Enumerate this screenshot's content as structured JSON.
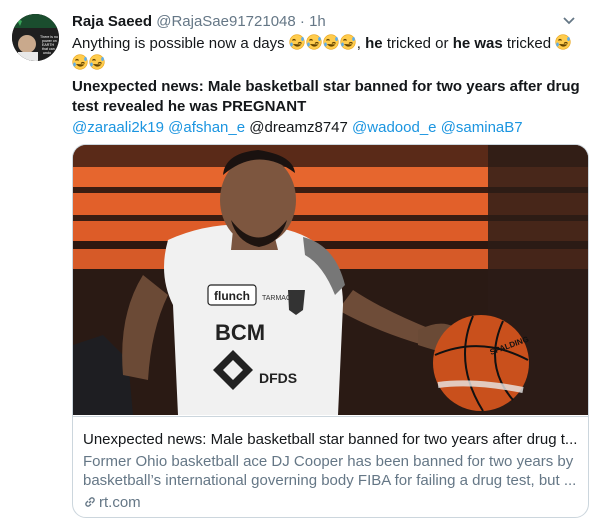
{
  "tweet": {
    "author_name": "Raja Saeed",
    "author_handle": "@RajaSae91721048",
    "separator": "·",
    "timestamp": "1h",
    "line1_text": "Anything is possible now a days ",
    "line1_he_1": "he",
    "line1_tricked_or": " tricked or ",
    "line1_he_was": "he was",
    "line1_tricked": " tricked ",
    "headline_line1": "Unexpected news: Male basketball star banned for two years after drug",
    "headline_line2": "test revealed he was PREGNANT",
    "mentions": [
      "@zaraali2k19",
      "@afshan_e",
      "@dreamz8747",
      "@wadood_e",
      "@saminaB7"
    ],
    "emoji": "rolling-on-floor-laughing-emoji",
    "avatar_text": [
      "There is no",
      "power on",
      "EARTH",
      "that can",
      "undo"
    ],
    "avatar_accent": "#3aa65a"
  },
  "card": {
    "title": "Unexpected news: Male basketball star banned for two years after drug t...",
    "description_line1": "Former Ohio basketball ace DJ Cooper has been banned for two years by",
    "description_line2": "basketball’s international governing body FIBA for failing a drug test, but ...",
    "domain": "rt.com",
    "jersey_brand": "flunch",
    "jersey_small": "TARMAC",
    "jersey_team": "BCM",
    "jersey_sponsor": "DFDS",
    "ball_brand": "SPALDING"
  },
  "colors": {
    "link": "#1b95e0",
    "secondary_text": "#657786",
    "border": "#ccd6dd"
  }
}
